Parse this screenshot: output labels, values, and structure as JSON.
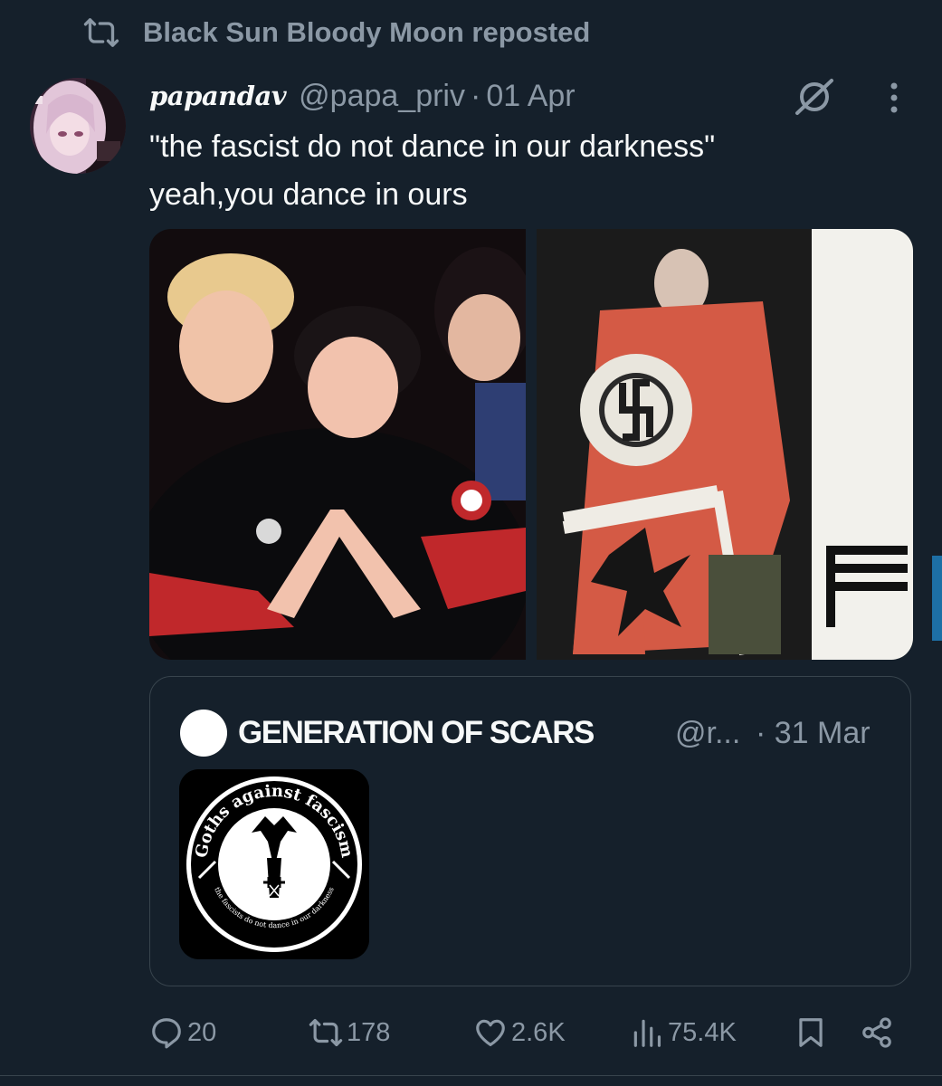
{
  "repost": {
    "text": "Black Sun Bloody Moon reposted",
    "icon": "repost-icon"
  },
  "tweet": {
    "author_name": "papandav",
    "handle": "@papa_priv",
    "separator": "·",
    "date": "01 Apr",
    "text_lines": [
      "\"the fascist do not dance in our darkness\"",
      "yeah,you dance in ours"
    ],
    "media": [
      {
        "icon": "photo-left"
      },
      {
        "icon": "photo-right"
      }
    ]
  },
  "quote": {
    "name": "GENERATION OF SCARS",
    "handle": "@r...",
    "date": "· 31 Mar",
    "thumb_text": {
      "top": "Goths against fascism",
      "bottom": "the fascists do not dance in our darkness"
    }
  },
  "actions": {
    "replies": "20",
    "reposts": "178",
    "likes": "2.6K",
    "views": "75.4K"
  },
  "colors": {
    "background": "#15202b",
    "text_primary": "#f7f9f9",
    "text_secondary": "#8b98a5",
    "border": "#38444d",
    "accent": "#1d6fa5"
  }
}
